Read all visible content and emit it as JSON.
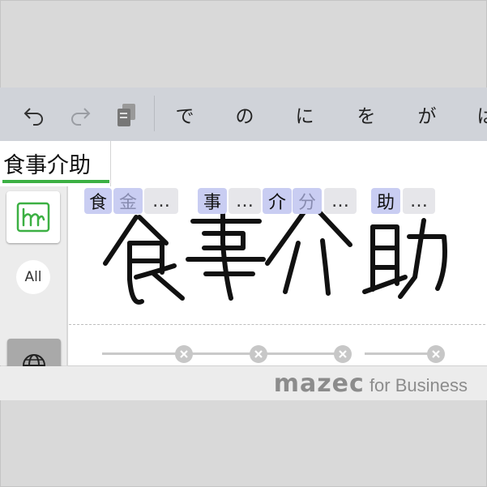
{
  "toolbar": {
    "undo_icon": "undo-icon",
    "redo_icon": "redo-icon",
    "paste_icon": "paste-icon",
    "suggestions": [
      "で",
      "の",
      "に",
      "を",
      "が",
      "は"
    ]
  },
  "candidates": {
    "first": "食事介助"
  },
  "chips": {
    "c1": "食",
    "c1_alt": "金",
    "c1_more": "…",
    "c2": "事",
    "c2_more": "…",
    "c3": "介",
    "c3_alt": "分",
    "c3_more": "…",
    "c4": "助",
    "c4_more": "…"
  },
  "sidebar": {
    "all_label": "All"
  },
  "brand": {
    "name": "mazec",
    "suffix": " for Business"
  },
  "colors": {
    "toolbar_bg": "#d0d3d9",
    "accent_green": "#3cb043",
    "chip_bg": "#c9cdf2"
  }
}
